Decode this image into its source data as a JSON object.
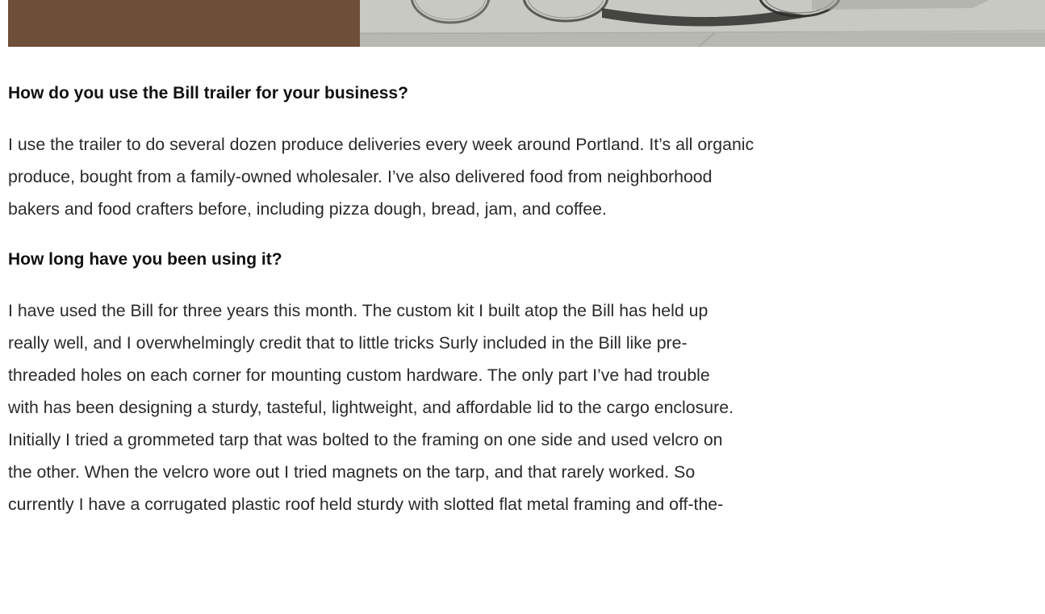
{
  "article": {
    "q1": "How do you use the Bill trailer for your business?",
    "a1_lines": [
      "I use the trailer to do several dozen produce deliveries every week around Portland. It’s all organic",
      "produce, bought from a family-owned wholesaler. I’ve also delivered food from neighborhood",
      "bakers and food crafters before, including pizza dough, bread, jam, and coffee."
    ],
    "q2": "How long have you been using it?",
    "a2_lines": [
      "I have used the Bill for three years this month. The custom kit I built atop the Bill has held up",
      "really well, and I overwhelmingly credit that to little tricks Surly included in the Bill like pre-",
      "threaded holes on each corner for mounting custom hardware. The only part I’ve had trouble",
      "with has been designing a sturdy, tasteful, lightweight, and affordable lid to the cargo enclosure.",
      "Initially I tried a grommeted tarp that was bolted to the framing on one side and used velcro on",
      "the other. When the velcro wore out I tried magnets on the tarp, and that rarely worked. So",
      "currently I have a corrugated plastic roof held sturdy with slotted flat metal framing and off-the-"
    ]
  },
  "colors": {
    "hero_brown": "#6f4f39",
    "heading_text": "#111111",
    "body_text": "#2a2a2a"
  }
}
